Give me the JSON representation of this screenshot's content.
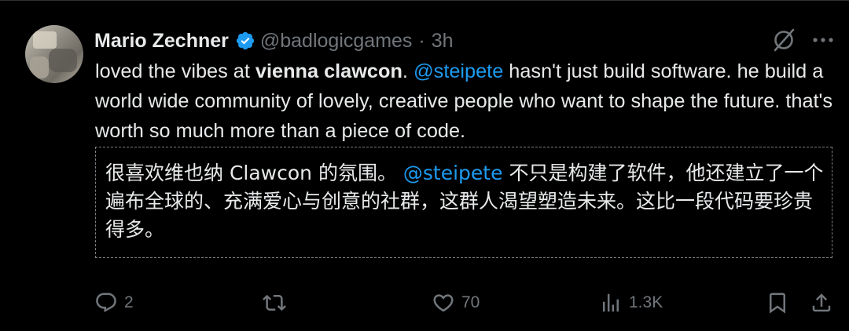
{
  "author": {
    "name": "Mario Zechner",
    "handle": "@badlogicgames",
    "separator": "·",
    "time": "3h"
  },
  "tweet": {
    "part1": "loved the vibes at ",
    "bold": "vienna clawcon",
    "part2": ". ",
    "mention": "@steipete",
    "part3": " hasn't just build software. he build a world wide community of lovely, creative people who want to shape the future. that's worth so much more than a piece of code."
  },
  "translation": {
    "part1": "很喜欢维也纳 Clawcon 的氛围。 ",
    "mention": "@steipete",
    "part2": " 不只是构建了软件，他还建立了一个遍布全球的、充满爱心与创意的社群，这群人渴望塑造未来。这比一段代码要珍贵得多。"
  },
  "actions": {
    "replies": "2",
    "reposts": "",
    "likes": "70",
    "views": "1.3K"
  },
  "icons": {
    "verified": "verified-badge-icon",
    "grok": "grok-icon",
    "more": "more-icon",
    "reply": "reply-icon",
    "repost": "repost-icon",
    "like": "like-icon",
    "views": "views-icon",
    "bookmark": "bookmark-icon",
    "share": "share-icon"
  },
  "colors": {
    "background": "#000000",
    "text": "#e7e9ea",
    "muted": "#71767b",
    "accent": "#1d9bf0"
  }
}
